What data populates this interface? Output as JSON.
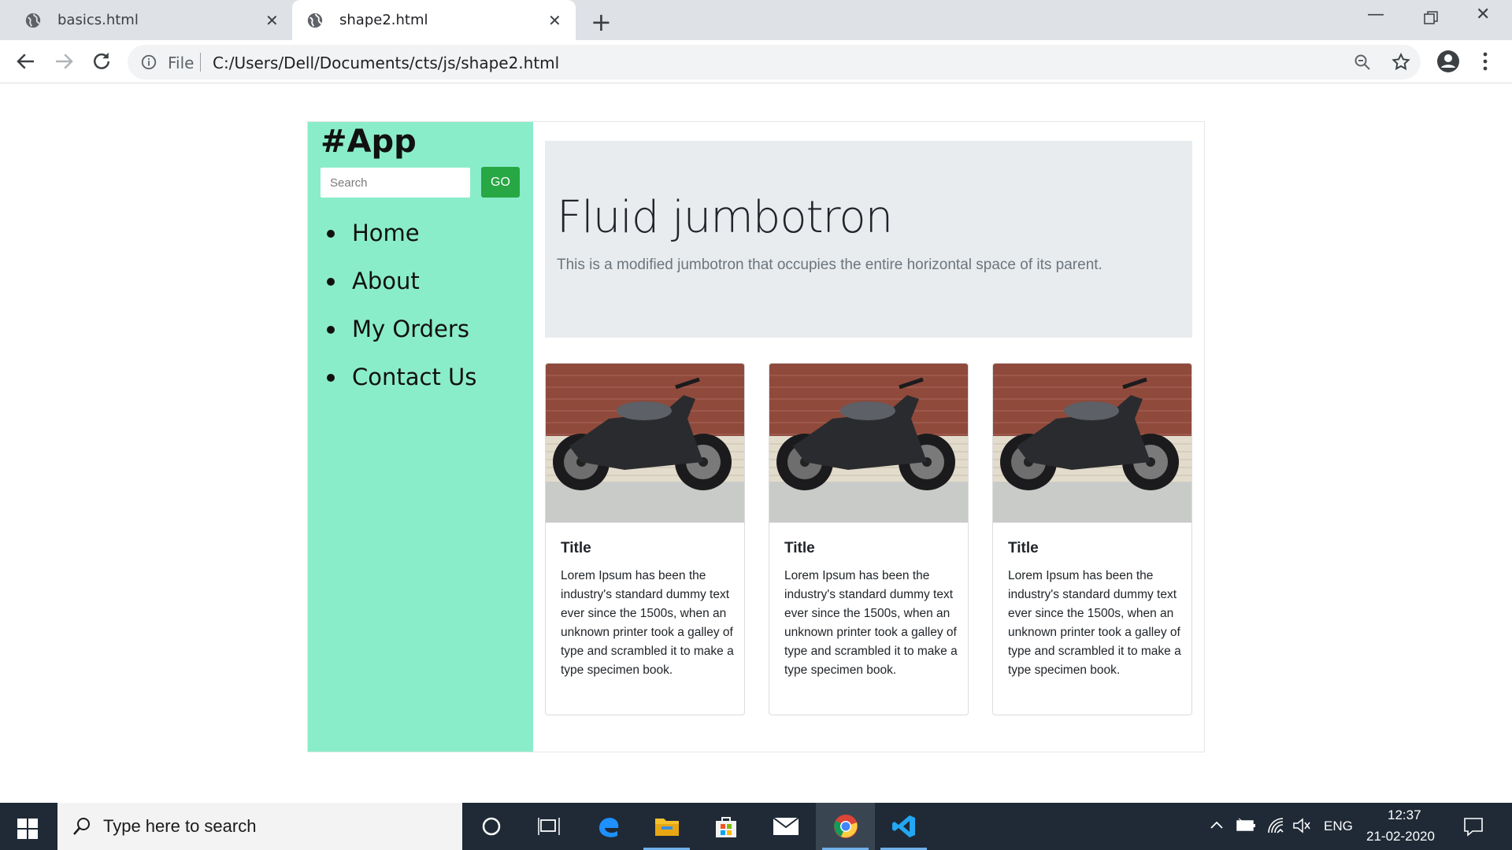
{
  "browser": {
    "tabs": [
      {
        "label": "basics.html"
      },
      {
        "label": "shape2.html"
      }
    ],
    "address": {
      "scheme_label": "File",
      "url": "C:/Users/Dell/Documents/cts/js/shape2.html"
    }
  },
  "app": {
    "brand": "#App",
    "search": {
      "placeholder": "Search",
      "button_label": "GO"
    },
    "nav": [
      {
        "label": "Home"
      },
      {
        "label": "About"
      },
      {
        "label": "My Orders"
      },
      {
        "label": "Contact Us"
      }
    ],
    "jumbotron": {
      "title": "Fluid jumbotron",
      "lead": "This is a modified jumbotron that occupies the entire horizontal space of its parent."
    },
    "cards": [
      {
        "title": "Title",
        "text": "Lorem Ipsum has been the industry's standard dummy text ever since the 1500s, when an unknown printer took a galley of type and scrambled it to make a type specimen book."
      },
      {
        "title": "Title",
        "text": "Lorem Ipsum has been the industry's standard dummy text ever since the 1500s, when an unknown printer took a galley of type and scrambled it to make a type specimen book."
      },
      {
        "title": "Title",
        "text": "Lorem Ipsum has been the industry's standard dummy text ever since the 1500s, when an unknown printer took a galley of type and scrambled it to make a type specimen book."
      }
    ]
  },
  "taskbar": {
    "search_placeholder": "Type here to search",
    "language": "ENG",
    "time": "12:37",
    "date": "21-02-2020"
  },
  "colors": {
    "sidebar": "#8aedc9",
    "go_button": "#28a745",
    "jumbotron": "#e9ecef",
    "taskbar": "#1f2a36"
  }
}
